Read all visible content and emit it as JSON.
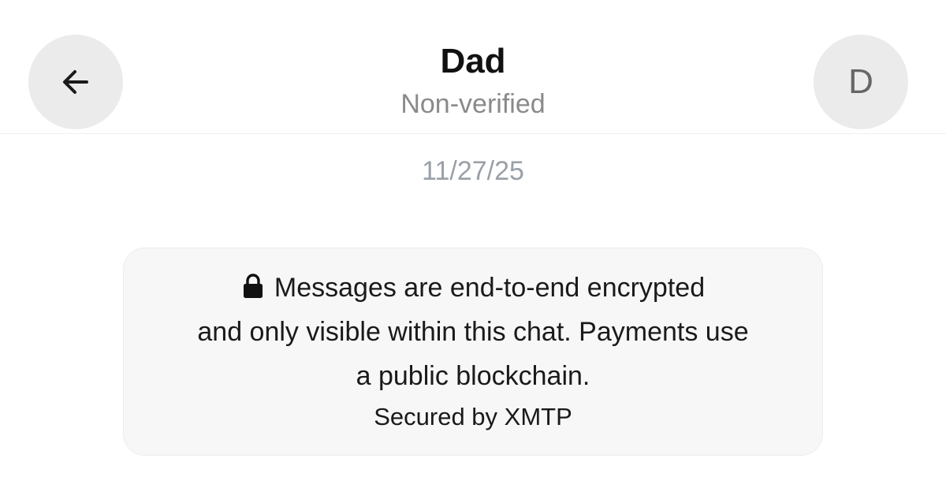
{
  "header": {
    "title": "Dad",
    "subtitle": "Non-verified",
    "back_icon": "arrow-left-icon",
    "avatar_initial": "D"
  },
  "conversation": {
    "date": "11/27/25"
  },
  "notice": {
    "icon": "lock-icon",
    "line1": "Messages are end-to-end encrypted",
    "line2": "and only visible within this chat. Payments use",
    "line3": "a public blockchain.",
    "footer": "Secured by XMTP"
  },
  "colors": {
    "button_bg": "#ebebeb",
    "subtitle": "#8a8a8a",
    "date": "#9aa0a8",
    "card_bg": "#f7f7f7"
  }
}
